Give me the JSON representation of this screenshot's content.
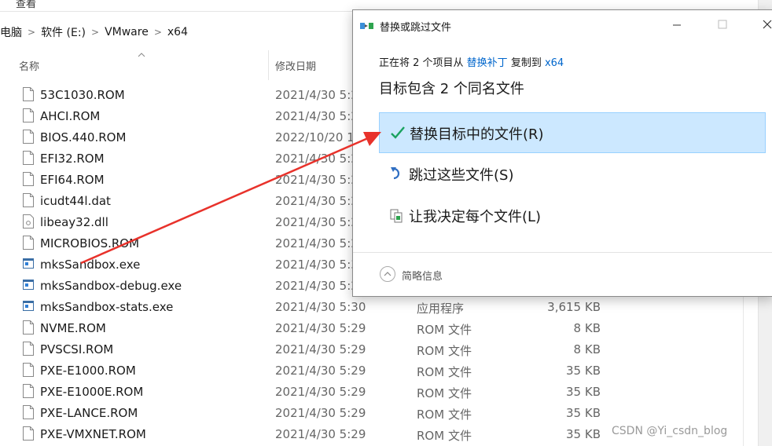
{
  "explorer": {
    "menu_label": "查看",
    "breadcrumb": [
      "电脑",
      "软件 (E:)",
      "VMware",
      "x64"
    ],
    "columns": {
      "name": "名称",
      "date": "修改日期"
    },
    "files": [
      {
        "name": "53C1030.ROM",
        "date": "2021/4/30 5:2",
        "type": "",
        "size": "",
        "icon": "file-icon"
      },
      {
        "name": "AHCI.ROM",
        "date": "2021/4/30 5:2",
        "type": "",
        "size": "",
        "icon": "file-icon"
      },
      {
        "name": "BIOS.440.ROM",
        "date": "2022/10/20 1",
        "type": "",
        "size": "",
        "icon": "file-icon"
      },
      {
        "name": "EFI32.ROM",
        "date": "2021/4/30 5:2",
        "type": "",
        "size": "",
        "icon": "file-icon"
      },
      {
        "name": "EFI64.ROM",
        "date": "2021/4/30 5:2",
        "type": "",
        "size": "",
        "icon": "file-icon"
      },
      {
        "name": "icudt44l.dat",
        "date": "2021/4/30 5:2",
        "type": "",
        "size": "",
        "icon": "file-icon"
      },
      {
        "name": "libeay32.dll",
        "date": "2021/4/30 5:2",
        "type": "",
        "size": "",
        "icon": "dll-icon"
      },
      {
        "name": "MICROBIOS.ROM",
        "date": "2021/4/30 5:2",
        "type": "",
        "size": "",
        "icon": "file-icon"
      },
      {
        "name": "mksSandbox.exe",
        "date": "2021/4/30 5:3",
        "type": "",
        "size": "",
        "icon": "exe-icon"
      },
      {
        "name": "mksSandbox-debug.exe",
        "date": "2021/4/30 5:2",
        "type": "",
        "size": "",
        "icon": "exe-icon"
      },
      {
        "name": "mksSandbox-stats.exe",
        "date": "2021/4/30 5:30",
        "type": "应用程序",
        "size": "3,615 KB",
        "icon": "exe-icon"
      },
      {
        "name": "NVME.ROM",
        "date": "2021/4/30 5:29",
        "type": "ROM 文件",
        "size": "8 KB",
        "icon": "file-icon"
      },
      {
        "name": "PVSCSI.ROM",
        "date": "2021/4/30 5:29",
        "type": "ROM 文件",
        "size": "8 KB",
        "icon": "file-icon"
      },
      {
        "name": "PXE-E1000.ROM",
        "date": "2021/4/30 5:29",
        "type": "ROM 文件",
        "size": "35 KB",
        "icon": "file-icon"
      },
      {
        "name": "PXE-E1000E.ROM",
        "date": "2021/4/30 5:29",
        "type": "ROM 文件",
        "size": "35 KB",
        "icon": "file-icon"
      },
      {
        "name": "PXE-LANCE.ROM",
        "date": "2021/4/30 5:29",
        "type": "ROM 文件",
        "size": "35 KB",
        "icon": "file-icon"
      },
      {
        "name": "PXE-VMXNET.ROM",
        "date": "2021/4/30 5:29",
        "type": "ROM 文件",
        "size": "35 KB",
        "icon": "file-icon"
      }
    ]
  },
  "dialog": {
    "title": "替换或跳过文件",
    "progress_prefix": "正在将 2 个项目从 ",
    "source": "替换补丁",
    "progress_mid": " 复制到 ",
    "destination": "x64",
    "heading": "目标包含 2 个同名文件",
    "options": [
      {
        "label": "替换目标中的文件(R)",
        "icon": "checkmark-icon",
        "selected": true
      },
      {
        "label": "跳过这些文件(S)",
        "icon": "skip-arrow-icon",
        "selected": false
      },
      {
        "label": "让我决定每个文件(L)",
        "icon": "compare-files-icon",
        "selected": false
      }
    ],
    "details_label": "简略信息"
  },
  "watermark": "CSDN @Yi_csdn_blog",
  "colors": {
    "accent_link": "#0066cc",
    "selection_bg": "#cce8ff",
    "arrow": "#e8322b",
    "check": "#1aa260"
  }
}
